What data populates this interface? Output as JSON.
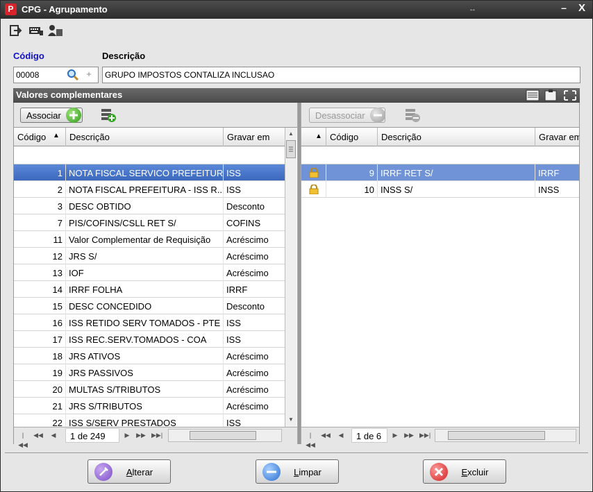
{
  "window": {
    "title": "CPG - Agrupamento",
    "icon_letter": "P",
    "resize_glyph": "↔",
    "minimize_glyph": "–",
    "close_glyph": "X"
  },
  "toolbar": {
    "icons": [
      "exit-icon",
      "keyboard-icon",
      "users-icon"
    ]
  },
  "form": {
    "codigo_label": "Código",
    "codigo_value": "00008",
    "descricao_label": "Descrição",
    "descricao_value": "GRUPO IMPOSTOS CONTALIZA INCLUSAO"
  },
  "section": {
    "title": "Valores complementares"
  },
  "left": {
    "associar_label": "Associar",
    "headers": {
      "codigo": "Código",
      "sort_arrow": "▲",
      "descricao": "Descrição",
      "gravar": "Gravar em"
    },
    "rows": [
      {
        "codigo": "1",
        "descricao": "NOTA FISCAL SERVICO PREFEITURA",
        "gravar": "ISS"
      },
      {
        "codigo": "2",
        "descricao": "NOTA FISCAL PREFEITURA - ISS R...",
        "gravar": "ISS"
      },
      {
        "codigo": "3",
        "descricao": "DESC OBTIDO",
        "gravar": "Desconto"
      },
      {
        "codigo": "7",
        "descricao": "PIS/COFINS/CSLL RET S/",
        "gravar": "COFINS"
      },
      {
        "codigo": "11",
        "descricao": "Valor Complementar de Requisição",
        "gravar": "Acréscimo"
      },
      {
        "codigo": "12",
        "descricao": "JRS S/",
        "gravar": "Acréscimo"
      },
      {
        "codigo": "13",
        "descricao": "IOF",
        "gravar": "Acréscimo"
      },
      {
        "codigo": "14",
        "descricao": "IRRF FOLHA",
        "gravar": "IRRF"
      },
      {
        "codigo": "15",
        "descricao": "DESC CONCEDIDO",
        "gravar": "Desconto"
      },
      {
        "codigo": "16",
        "descricao": "ISS RETIDO SERV TOMADOS - PTE",
        "gravar": "ISS"
      },
      {
        "codigo": "17",
        "descricao": "ISS REC.SERV.TOMADOS - COA",
        "gravar": "ISS"
      },
      {
        "codigo": "18",
        "descricao": "JRS ATIVOS",
        "gravar": "Acréscimo"
      },
      {
        "codigo": "19",
        "descricao": "JRS PASSIVOS",
        "gravar": "Acréscimo"
      },
      {
        "codigo": "20",
        "descricao": "MULTAS S/TRIBUTOS",
        "gravar": "Acréscimo"
      },
      {
        "codigo": "21",
        "descricao": "JRS S/TRIBUTOS",
        "gravar": "Acréscimo"
      },
      {
        "codigo": "22",
        "descricao": "ISS S/SERV PRESTADOS",
        "gravar": "ISS"
      }
    ],
    "pager_text": "1 de 249"
  },
  "right": {
    "desassociar_label": "Desassociar",
    "headers": {
      "sort_arrow": "▲",
      "codigo": "Código",
      "descricao": "Descrição",
      "gravar": "Gravar em"
    },
    "rows": [
      {
        "codigo": "9",
        "descricao": "IRRF RET S/",
        "gravar": "IRRF"
      },
      {
        "codigo": "10",
        "descricao": "INSS S/",
        "gravar": "INSS"
      }
    ],
    "pager_text": "1 de 6"
  },
  "footer": {
    "alterar_first": "A",
    "alterar_rest": "lterar",
    "limpar_first": "L",
    "limpar_rest": "impar",
    "excluir_first": "E",
    "excluir_rest": "xcluir"
  },
  "colors": {
    "selection": "#3b68bd",
    "codigo_label": "#1010c8",
    "titlebar": "#2c2c2c"
  }
}
